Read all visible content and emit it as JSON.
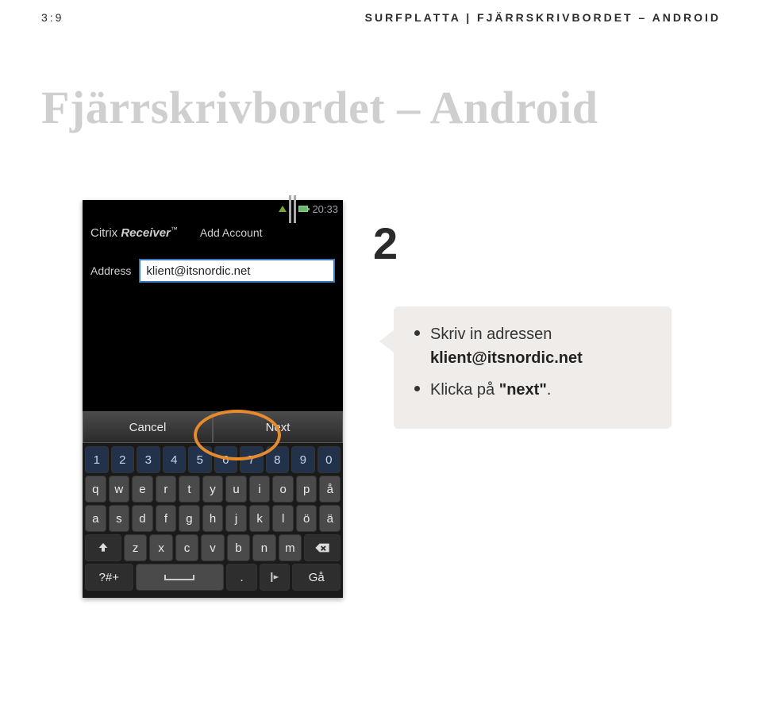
{
  "header": {
    "page_num": "3:9",
    "right": "SURFPLATTA | FJÄRRSKRIVBORDET – ANDROID"
  },
  "section_title": "Fjärrskrivbordet – Android",
  "step_number": "2",
  "statusbar": {
    "time": "20:33"
  },
  "appbar": {
    "brand_1": "Citrix",
    "brand_2": "Receiver",
    "tm": "™",
    "title": "Add Account"
  },
  "form": {
    "address_label": "Address",
    "address_value": "klient@itsnordic.net"
  },
  "buttons": {
    "cancel": "Cancel",
    "next": "Next"
  },
  "keyboard": {
    "row1": [
      "1",
      "2",
      "3",
      "4",
      "5",
      "6",
      "7",
      "8",
      "9",
      "0"
    ],
    "row2": [
      "q",
      "w",
      "e",
      "r",
      "t",
      "y",
      "u",
      "i",
      "o",
      "p",
      "å"
    ],
    "row3": [
      "a",
      "s",
      "d",
      "f",
      "g",
      "h",
      "j",
      "k",
      "l",
      "ö",
      "ä"
    ],
    "row4": [
      "z",
      "x",
      "c",
      "v",
      "b",
      "n",
      "m"
    ],
    "sym": "?#+",
    "period": ".",
    "go": "Gå"
  },
  "callout": {
    "line1_pre": "Skriv in adressen ",
    "line1_bold": "klient@itsnordic.net",
    "line2_pre": "Klicka på ",
    "line2_bold": "\"next\"",
    "line2_post": "."
  }
}
